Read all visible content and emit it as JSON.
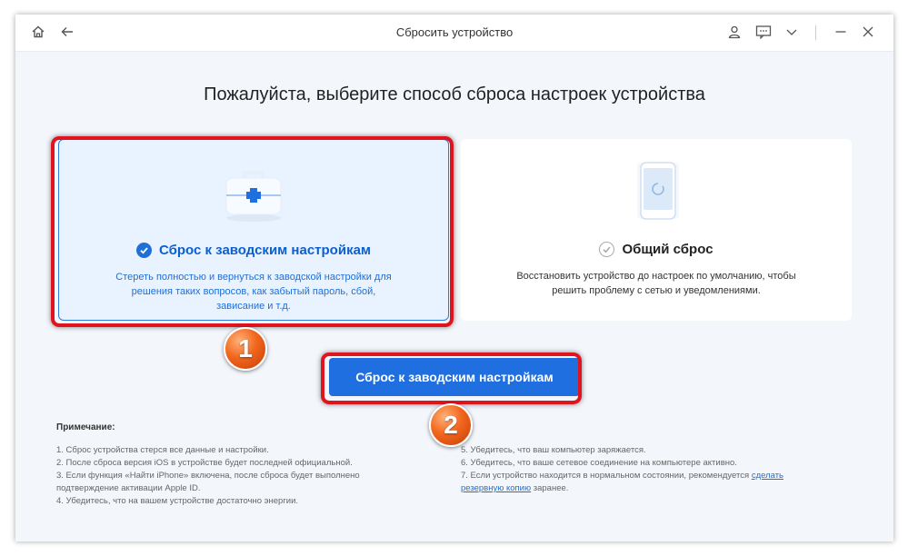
{
  "window": {
    "title": "Сбросить устройство"
  },
  "heading": "Пожалуйста, выберите способ сброса настроек устройства",
  "options": [
    {
      "title": "Сброс к заводским настройкам",
      "desc_lines": [
        "Стереть полностью и вернуться к заводской настройки для",
        "решения таких вопросов, как забытый пароль, сбой,",
        "зависание и т.д."
      ],
      "selected": true
    },
    {
      "title": "Общий сброс",
      "desc_lines": [
        "Восстановить устройство до настроек по умолчанию, чтобы",
        "решить проблему с сетью и уведомлениями."
      ],
      "selected": false
    }
  ],
  "primary_button": "Сброс к заводским настройкам",
  "badges": [
    "1",
    "2"
  ],
  "notes": {
    "title": "Примечание:",
    "left": [
      "1. Сброс устройства стерся все данные и настройки.",
      "2. После сброса версия iOS в устройстве будет последней официальной.",
      "3. Если функция «Найти iPhone» включена, после сброса будет выполнено",
      "подтверждение активации Apple ID.",
      "4. Убедитесь, что на вашем устройстве достаточно энергии."
    ],
    "right": [
      "5. Убедитесь, что ваш компьютер заряжается.",
      "6. Убедитесь, что ваше сетевое соединение на компьютере активно."
    ],
    "right_7_before": "7. Если устройство находится в нормальном состоянии, рекомендуется ",
    "right_7_link_a": "сделать",
    "right_7_link_b": "резервную копию",
    "right_7_after": " заранее."
  },
  "colors": {
    "accent": "#1f6fe0",
    "highlight": "#e0141e",
    "badge": "#f2661c"
  },
  "icons": [
    "home-icon",
    "back-arrow-icon",
    "user-icon",
    "feedback-icon",
    "chevron-down-icon",
    "minimize-icon",
    "close-icon",
    "medical-kit-icon",
    "phone-reset-icon",
    "check-circle-icon"
  ]
}
